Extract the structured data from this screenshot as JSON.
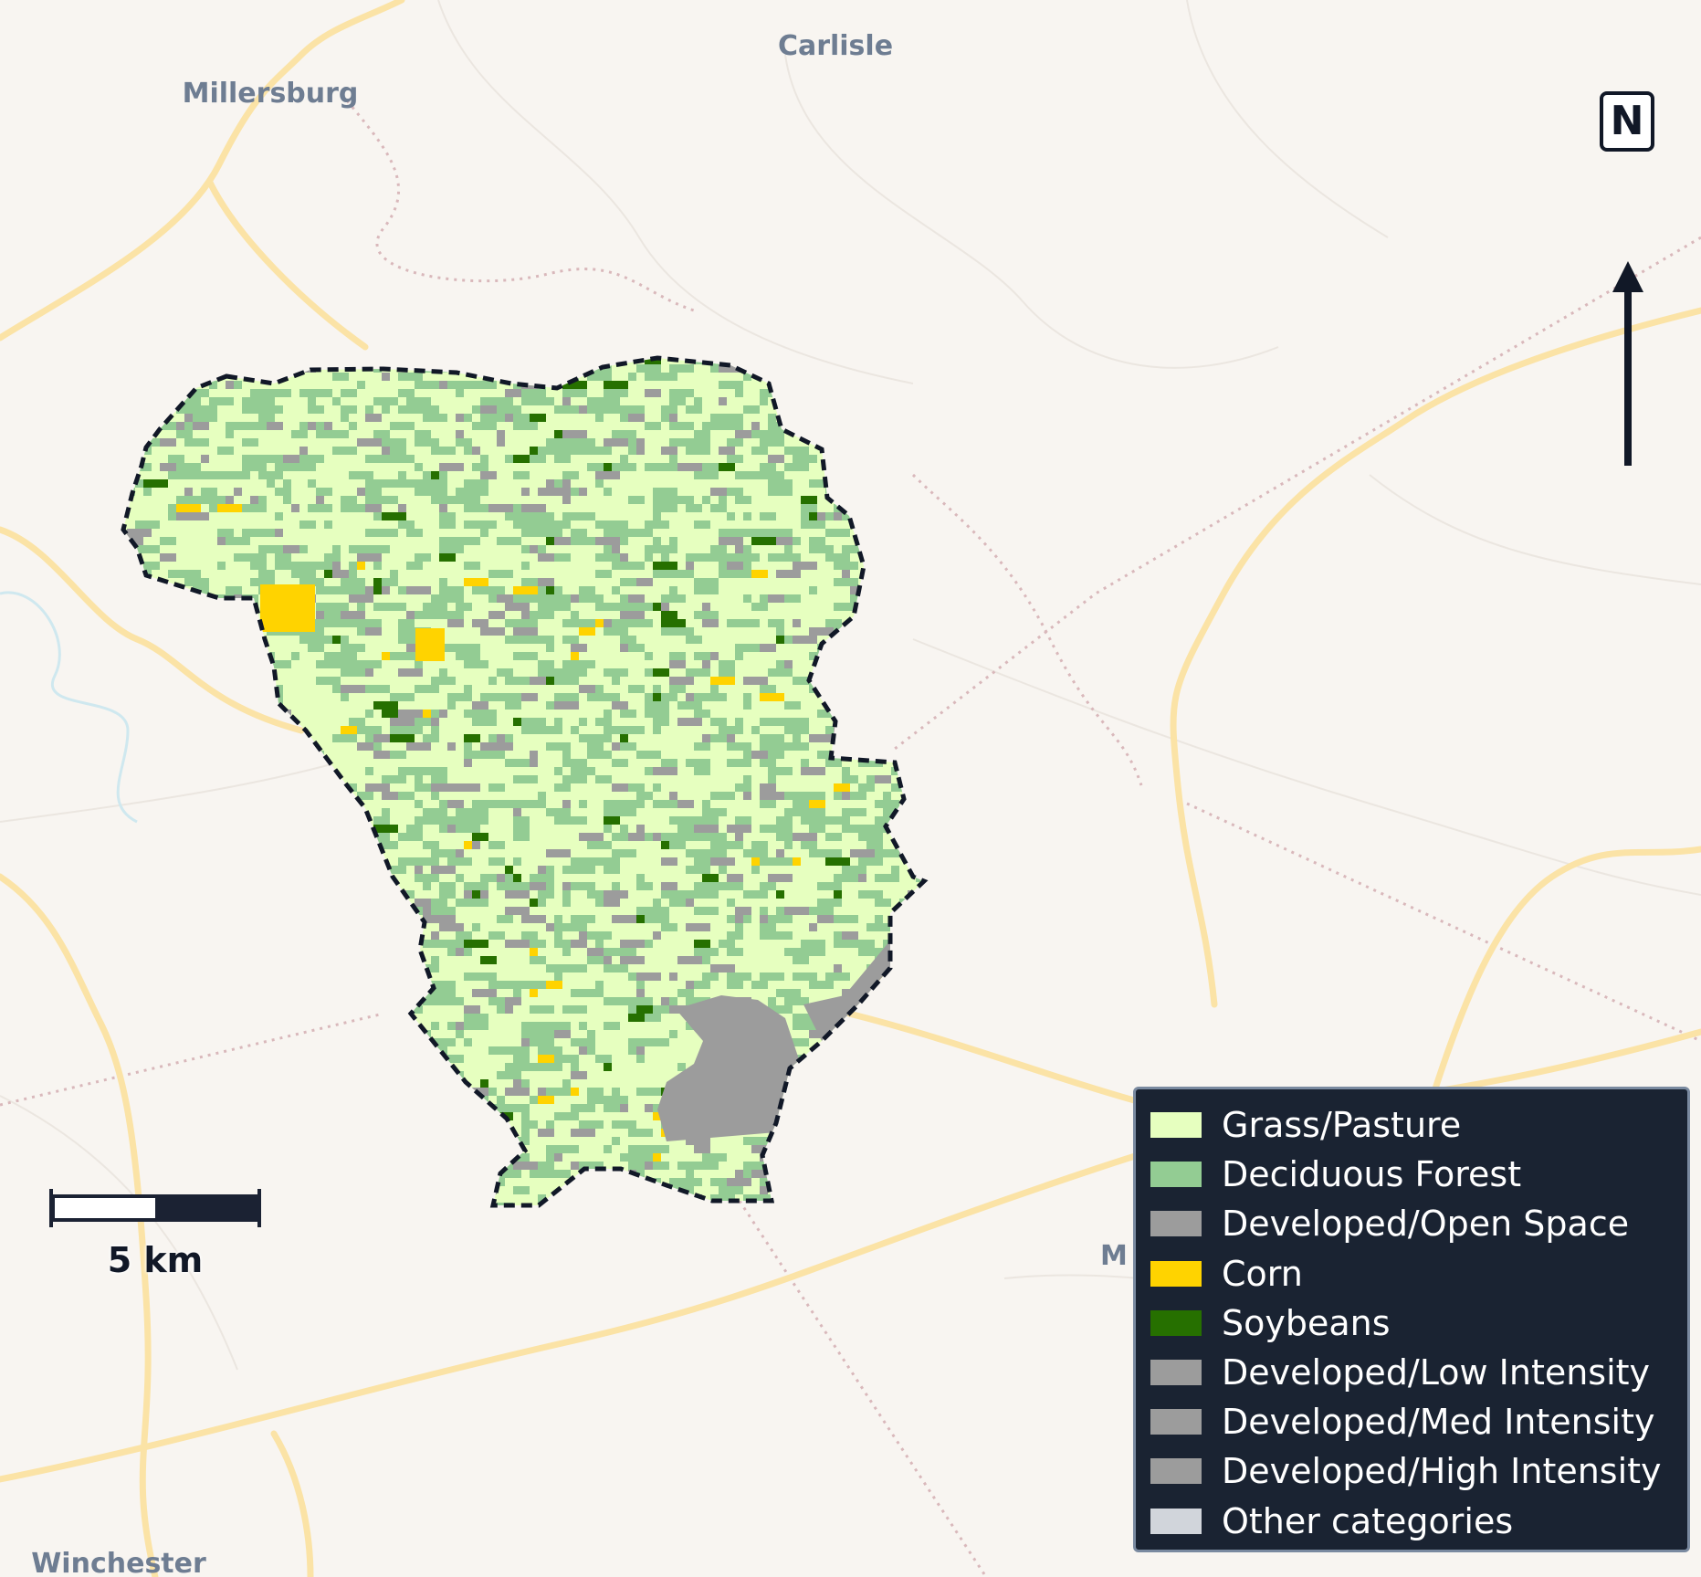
{
  "map": {
    "places": [
      {
        "name": "Millersburg"
      },
      {
        "name": "Carlisle"
      },
      {
        "name": "Winchester"
      },
      {
        "name": "M"
      }
    ]
  },
  "north_arrow": {
    "label": "N",
    "icon": "north-arrow-icon"
  },
  "scale_bar": {
    "label": "5 km"
  },
  "legend": {
    "items": [
      {
        "label": "Grass/Pasture",
        "color": "#e6ffbf"
      },
      {
        "label": "Deciduous Forest",
        "color": "#93cc93"
      },
      {
        "label": "Developed/Open Space",
        "color": "#9c9c9c"
      },
      {
        "label": "Corn",
        "color": "#ffd300"
      },
      {
        "label": "Soybeans",
        "color": "#267000"
      },
      {
        "label": "Developed/Low Intensity",
        "color": "#9c9c9c"
      },
      {
        "label": "Developed/Med Intensity",
        "color": "#9c9c9c"
      },
      {
        "label": "Developed/High Intensity",
        "color": "#9c9c9c"
      },
      {
        "label": "Other categories",
        "color": "#d1d5db"
      }
    ]
  }
}
